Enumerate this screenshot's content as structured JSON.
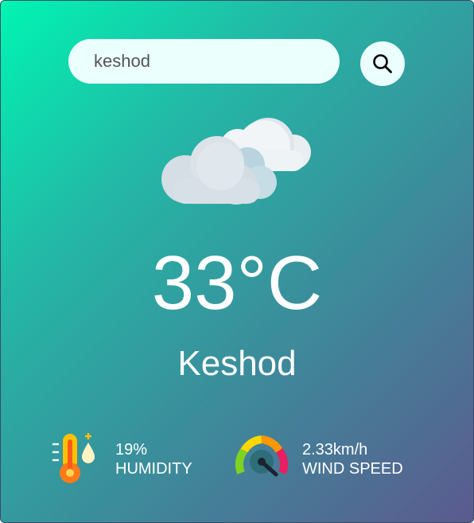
{
  "search": {
    "value": "keshod",
    "placeholder": ""
  },
  "icons": {
    "search": "search-icon",
    "weather": "cloud-icon",
    "humidity": "humidity-thermometer-icon",
    "wind": "wind-speed-gauge-icon"
  },
  "weather": {
    "temperature": "33°C",
    "city": "Keshod"
  },
  "details": {
    "humidity_value": "19%",
    "humidity_label": "HUMIDITY",
    "wind_value": "2.33km/h",
    "wind_label": "WIND SPEED"
  },
  "colors": {
    "gradient_start": "#00f5b2",
    "gradient_end": "#5b5a8e",
    "text": "#ffffff"
  }
}
